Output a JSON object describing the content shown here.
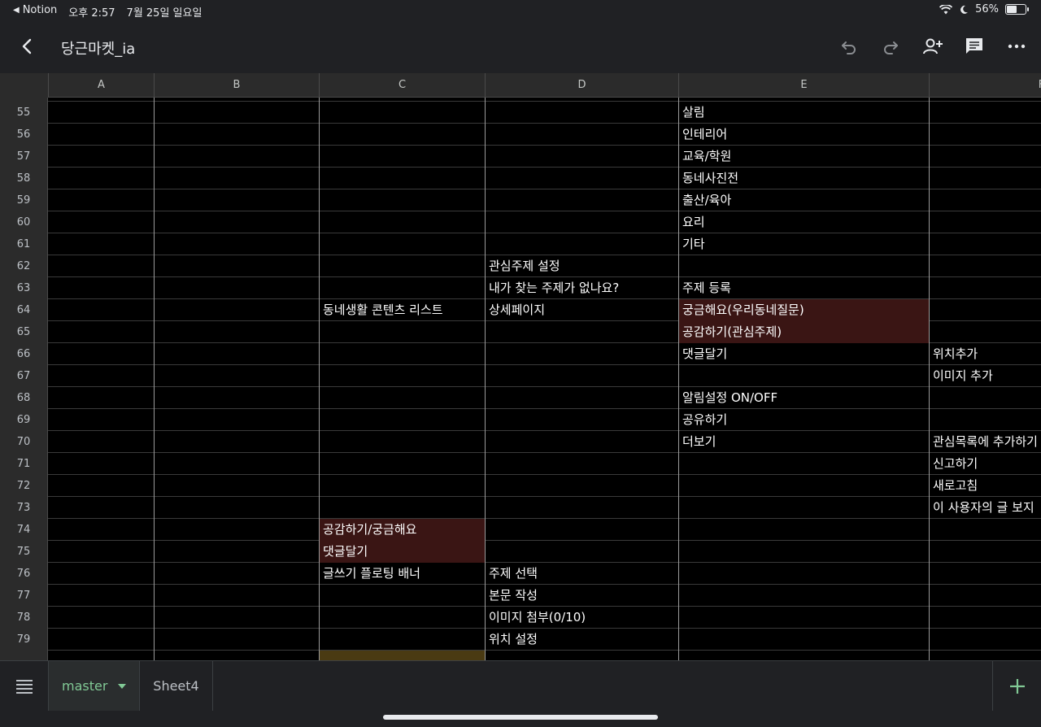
{
  "status_bar": {
    "back_app": "Notion",
    "time": "오후 2:57",
    "date": "7월 25일 일요일",
    "battery": "56%",
    "battery_level": 0.56
  },
  "toolbar": {
    "title": "당근마켓_ia"
  },
  "columns": [
    "A",
    "B",
    "C",
    "D",
    "E",
    "F"
  ],
  "rows": [
    {
      "num": "55",
      "C": "",
      "D": "",
      "E": "살림",
      "F": ""
    },
    {
      "num": "56",
      "C": "",
      "D": "",
      "E": "인테리어",
      "F": ""
    },
    {
      "num": "57",
      "C": "",
      "D": "",
      "E": "교육/학원",
      "F": ""
    },
    {
      "num": "58",
      "C": "",
      "D": "",
      "E": "동네사진전",
      "F": ""
    },
    {
      "num": "59",
      "C": "",
      "D": "",
      "E": "출산/육아",
      "F": ""
    },
    {
      "num": "60",
      "C": "",
      "D": "",
      "E": "요리",
      "F": ""
    },
    {
      "num": "61",
      "C": "",
      "D": "",
      "E": "기타",
      "F": ""
    },
    {
      "num": "62",
      "C": "",
      "D": "관심주제 설정",
      "E": "",
      "F": ""
    },
    {
      "num": "63",
      "C": "",
      "D": "내가 찾는 주제가 없나요?",
      "E": "주제 등록",
      "F": ""
    },
    {
      "num": "64",
      "C": "동네생활 콘텐츠 리스트",
      "D": "상세페이지",
      "E": "궁금해요(우리동네질문)",
      "F": ""
    },
    {
      "num": "65",
      "C": "",
      "D": "",
      "E": "공감하기(관심주제)",
      "F": ""
    },
    {
      "num": "66",
      "C": "",
      "D": "",
      "E": "댓글달기",
      "F": "위치추가"
    },
    {
      "num": "67",
      "C": "",
      "D": "",
      "E": "",
      "F": "이미지 추가"
    },
    {
      "num": "68",
      "C": "",
      "D": "",
      "E": "알림설정 ON/OFF",
      "F": ""
    },
    {
      "num": "69",
      "C": "",
      "D": "",
      "E": "공유하기",
      "F": ""
    },
    {
      "num": "70",
      "C": "",
      "D": "",
      "E": "더보기",
      "F": "관심목록에 추가하기"
    },
    {
      "num": "71",
      "C": "",
      "D": "",
      "E": "",
      "F": "신고하기"
    },
    {
      "num": "72",
      "C": "",
      "D": "",
      "E": "",
      "F": "새로고침"
    },
    {
      "num": "73",
      "C": "",
      "D": "",
      "E": "",
      "F": "이 사용자의 글 보지"
    },
    {
      "num": "74",
      "C": "공감하기/궁금해요",
      "D": "",
      "E": "",
      "F": ""
    },
    {
      "num": "75",
      "C": "댓글달기",
      "D": "",
      "E": "",
      "F": ""
    },
    {
      "num": "76",
      "C": "글쓰기 플로팅 배너",
      "D": "주제 선택",
      "E": "",
      "F": ""
    },
    {
      "num": "77",
      "C": "",
      "D": "본문 작성",
      "E": "",
      "F": ""
    },
    {
      "num": "78",
      "C": "",
      "D": "이미지 첨부(0/10)",
      "E": "",
      "F": ""
    },
    {
      "num": "79",
      "C": "",
      "D": "위치 설정",
      "E": "",
      "F": ""
    }
  ],
  "sheet_tabs": [
    "master",
    "Sheet4"
  ],
  "colors": {
    "highlight_red": "#3a1514",
    "active_tab_green": "#81c995"
  }
}
